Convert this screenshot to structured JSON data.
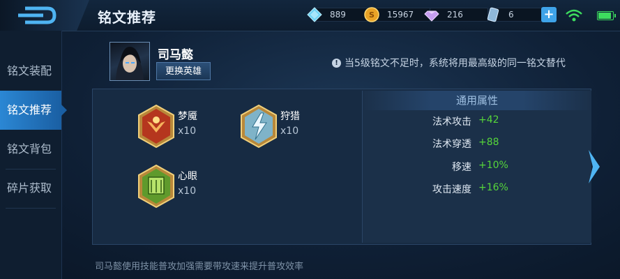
{
  "header": {
    "title": "铭文推荐",
    "resources": [
      {
        "icon": "diamond-icon",
        "value": "889"
      },
      {
        "icon": "gold-coin-icon",
        "value": "15967"
      },
      {
        "icon": "gem-icon",
        "value": "216"
      },
      {
        "icon": "ticket-icon",
        "value": "6"
      }
    ],
    "add_label": "+"
  },
  "sidebar": {
    "items": [
      {
        "label": "铭文装配",
        "active": false
      },
      {
        "label": "铭文推荐",
        "active": true
      },
      {
        "label": "铭文背包",
        "active": false
      },
      {
        "label": "碎片获取",
        "active": false
      }
    ]
  },
  "hero": {
    "name": "司马懿",
    "change_label": "更换英雄"
  },
  "notice": "当5级铭文不足时，系统将用最高级的同一铭文替代",
  "runes": [
    {
      "name": "梦魇",
      "count": "x10",
      "color": "red"
    },
    {
      "name": "狩猎",
      "count": "x10",
      "color": "blue"
    },
    {
      "name": "心眼",
      "count": "x10",
      "color": "green"
    }
  ],
  "attributes": {
    "header": "通用属性",
    "rows": [
      {
        "label": "法术攻击",
        "value": "+42"
      },
      {
        "label": "法术穿透",
        "value": "+88"
      },
      {
        "label": "移速",
        "value": "+10%"
      },
      {
        "label": "攻击速度",
        "value": "+16%"
      }
    ]
  },
  "footer": "司马懿使用技能普攻加强需要带攻速来提升普攻效率",
  "colors": {
    "accent": "#2b87d4",
    "positive": "#56d63a",
    "panel": "#172b43"
  }
}
